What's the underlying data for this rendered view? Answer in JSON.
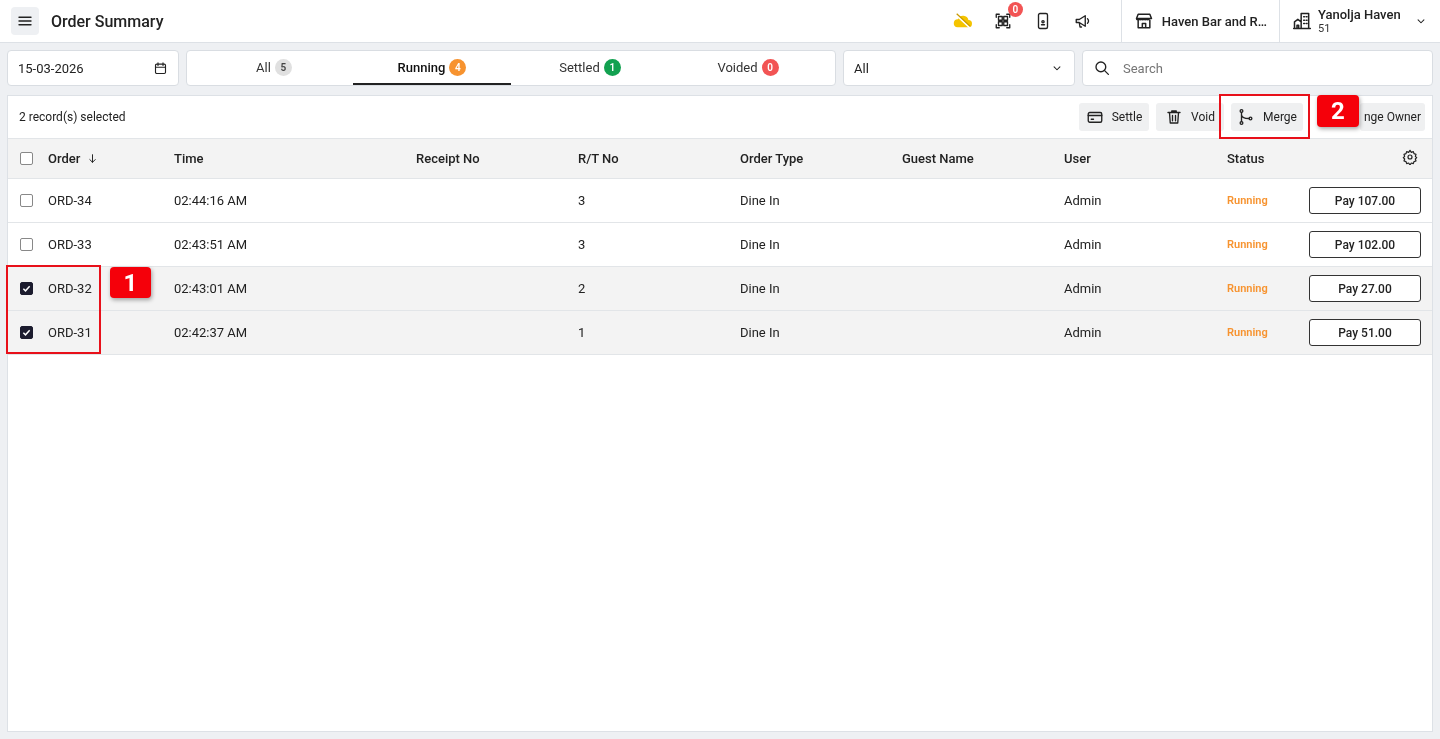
{
  "topbar": {
    "title": "Order Summary",
    "notification_count": "0",
    "store": "Haven Bar and R…",
    "org_name": "Yanolja Haven",
    "org_sub": "51"
  },
  "filters": {
    "date": "15-03-2026",
    "tabs": [
      {
        "label": "All",
        "count": "5",
        "color": "#e0e0e0",
        "selected": false
      },
      {
        "label": "Running",
        "count": "4",
        "color": "#f7932f",
        "selected": true
      },
      {
        "label": "Settled",
        "count": "1",
        "color": "#12a150",
        "selected": false
      },
      {
        "label": "Voided",
        "count": "0",
        "color": "#f25454",
        "selected": false
      }
    ],
    "type_select": "All",
    "search": {
      "placeholder": "Search"
    }
  },
  "toolbar": {
    "selection": "2 record(s) selected",
    "actions": [
      {
        "kind": "settle",
        "label": "Settle"
      },
      {
        "kind": "void",
        "label": "Void"
      },
      {
        "kind": "merge",
        "label": "Merge"
      },
      {
        "kind": "owner",
        "label": "nge Owner"
      }
    ]
  },
  "table": {
    "all_checked": false,
    "columns": [
      "Order",
      "Time",
      "Receipt No",
      "R/T No",
      "Order Type",
      "Guest Name",
      "User",
      "Status"
    ],
    "rows": [
      {
        "checked": false,
        "order": "ORD-34",
        "time": "02:44:16 AM",
        "rt": "3",
        "type": "Dine In",
        "user": "Admin",
        "status": "Running",
        "pay": "Pay 107.00"
      },
      {
        "checked": false,
        "order": "ORD-33",
        "time": "02:43:51 AM",
        "rt": "3",
        "type": "Dine In",
        "user": "Admin",
        "status": "Running",
        "pay": "Pay 102.00"
      },
      {
        "checked": true,
        "order": "ORD-32",
        "time": "02:43:01 AM",
        "rt": "2",
        "type": "Dine In",
        "user": "Admin",
        "status": "Running",
        "pay": "Pay 27.00"
      },
      {
        "checked": true,
        "order": "ORD-31",
        "time": "02:42:37 AM",
        "rt": "1",
        "type": "Dine In",
        "user": "Admin",
        "status": "Running",
        "pay": "Pay 51.00"
      }
    ]
  },
  "annotations": [
    {
      "label": "1"
    },
    {
      "label": "2"
    }
  ]
}
